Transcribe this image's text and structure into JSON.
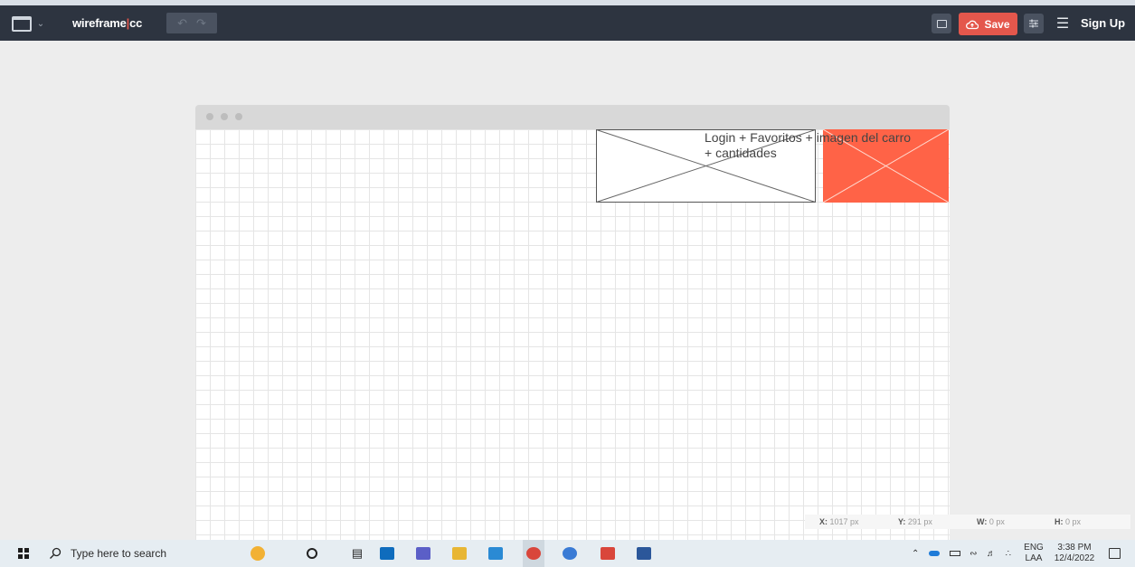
{
  "app": {
    "logo_main": "wireframe",
    "logo_sep": "|",
    "logo_suffix": "cc",
    "undo_glyph": "↶",
    "redo_glyph": "↷",
    "save_label": "Save",
    "signup_label": "Sign Up"
  },
  "canvas": {
    "placeholder_text": "Login + Favoritos + imagen del carro + cantidades",
    "placeholder_fill_colors": [
      "#ffffff",
      "#ff6347"
    ]
  },
  "status": {
    "x_label": "X:",
    "x_value": "1017 px",
    "y_label": "Y:",
    "y_value": "291 px",
    "w_label": "W:",
    "w_value": "0 px",
    "h_label": "H:",
    "h_value": "0 px"
  },
  "taskbar": {
    "search_placeholder": "Type here to search",
    "lang_top": "ENG",
    "lang_bottom": "LAA",
    "time": "3:38 PM",
    "date": "12/4/2022"
  },
  "colors": {
    "topbar_bg": "#2d3440",
    "accent": "#e4574c",
    "placeholder_orange": "#ff6347"
  }
}
